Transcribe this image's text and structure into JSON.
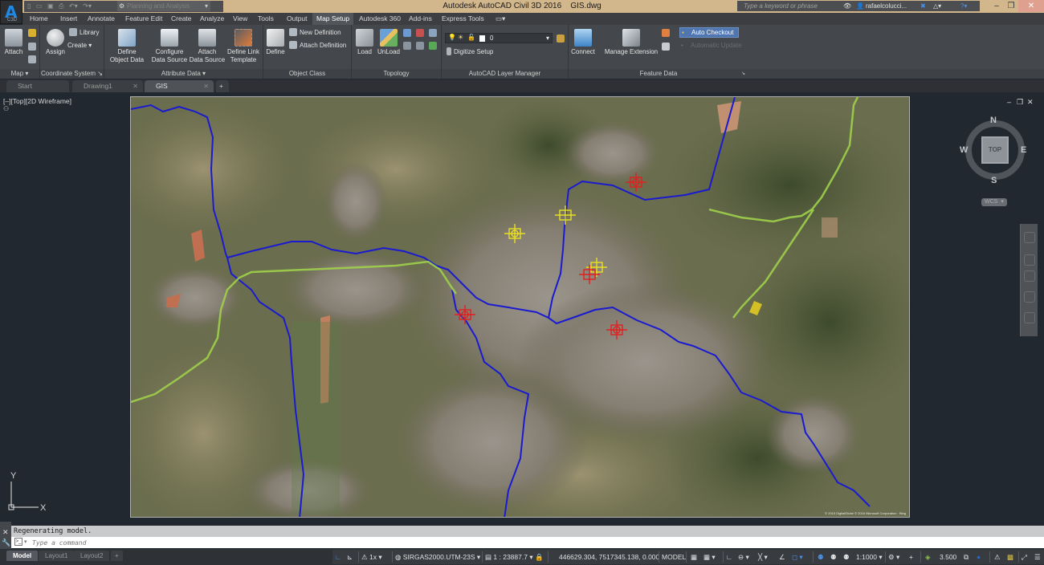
{
  "window": {
    "app_title": "Autodesk AutoCAD Civil 3D 2016",
    "file_name": "GIS.dwg",
    "app_button_label": "C3D",
    "workspace": "Planning and Analysis",
    "search_placeholder": "Type a keyword or phrase",
    "username": "rafaelcolucci...",
    "controls": {
      "minimize": "–",
      "restore": "❐",
      "close": "✕"
    }
  },
  "ribbon": {
    "tabs": [
      "Home",
      "Insert",
      "Annotate",
      "Feature Edit",
      "Create",
      "Analyze",
      "View",
      "Tools",
      "Output",
      "Map Setup",
      "Autodesk 360",
      "Add-ins",
      "Express Tools"
    ],
    "active_tab": "Map Setup",
    "groups": {
      "map": {
        "label": "Map ▾",
        "attach": "Attach"
      },
      "coordinate_system": {
        "label": "Coordinate System ↘",
        "assign": "Assign",
        "library": "Library",
        "create": "Create ▾"
      },
      "attribute_data": {
        "label": "Attribute Data ▾",
        "define_object_data": [
          "Define",
          "Object Data"
        ],
        "configure_data_source": [
          "Configure",
          "Data Source"
        ],
        "attach_data_source": [
          "Attach",
          "Data Source"
        ],
        "define_link_template": [
          "Define Link",
          "Template"
        ]
      },
      "object_class": {
        "label": "Object Class",
        "define": "Define",
        "new_definition": "New Definition",
        "attach_definition": "Attach Definition"
      },
      "topology": {
        "label": "Topology",
        "load": "Load",
        "unload": "UnLoad"
      },
      "layer_manager": {
        "label": "AutoCAD Layer Manager",
        "current_layer": "0",
        "digitize_setup": "Digitize Setup"
      },
      "feature_data": {
        "label": "Feature Data",
        "connect": "Connect",
        "manage_extension": "Manage Extension",
        "auto_checkout": "Auto Checkout",
        "automatic_update": "Automatic Update"
      }
    }
  },
  "doc_tabs": [
    {
      "label": "Start",
      "closable": false
    },
    {
      "label": "Drawing1",
      "closable": true
    },
    {
      "label": "GIS",
      "closable": true,
      "active": true
    }
  ],
  "viewport": {
    "label": "[–][Top][2D Wireframe]",
    "viewcube": {
      "n": "N",
      "s": "S",
      "e": "E",
      "w": "W",
      "face": "TOP",
      "wcs": "WCS"
    },
    "ucs": {
      "x": "X",
      "y": "Y"
    },
    "map_copyright": "© 2015 DigitalGlobe © 2016 Microsoft Corporation · Bing",
    "colors": {
      "river": "#1a1ad0",
      "road": "#9fd04a",
      "marker_red": "#e02020",
      "marker_yellow": "#e8e020"
    }
  },
  "command": {
    "history": "Regenerating model.",
    "placeholder": "Type a command"
  },
  "layout_tabs": [
    "Model",
    "Layout1",
    "Layout2"
  ],
  "status": {
    "annotation_scale_icon": "1x",
    "coordinate_system": "SIRGAS2000.UTM-23S",
    "scale": "1 : 23887.7",
    "coordinates": "446629.304, 7517345.138, 0.000",
    "space": "MODEL",
    "annotation_scale": "1:1000",
    "lineweight": "3.500"
  }
}
